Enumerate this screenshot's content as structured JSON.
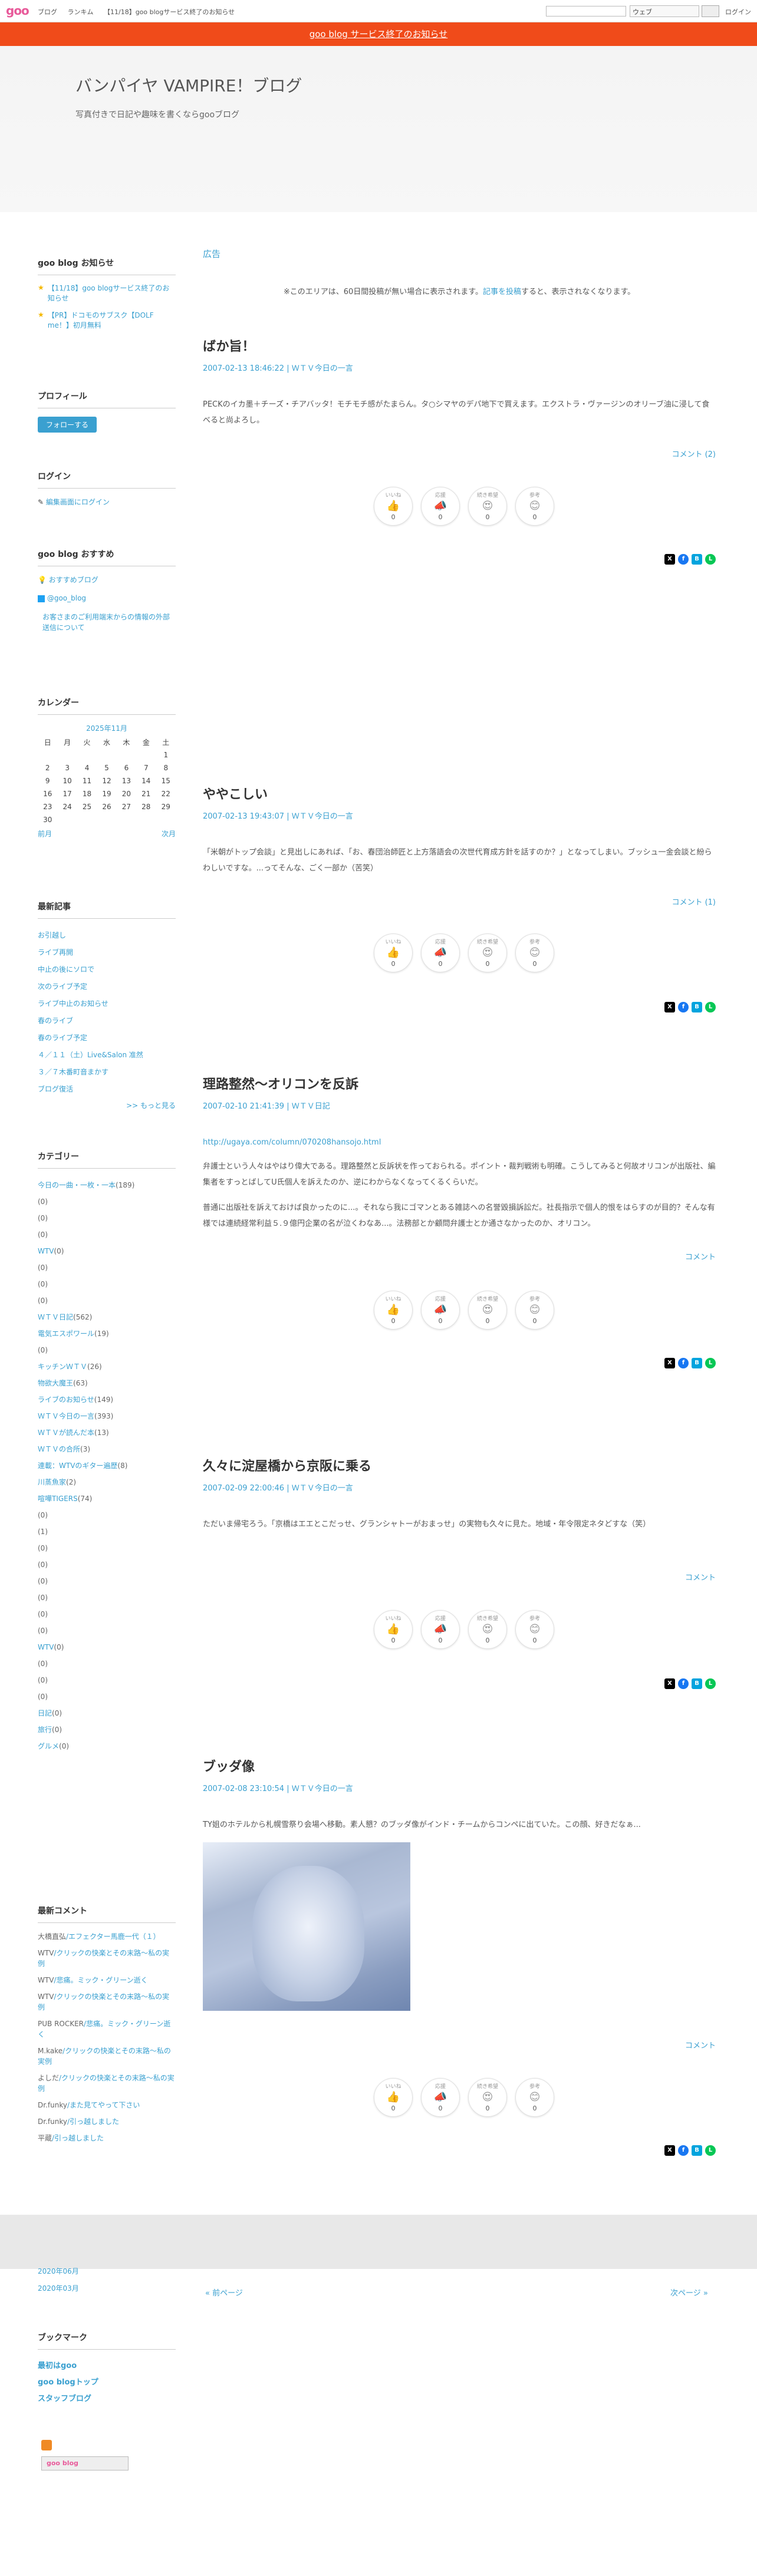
{
  "topbar": {
    "logo": "goo",
    "nav": [
      "ブログ",
      "ランキム",
      "【11/18】goo blogサービス終了のお知らせ"
    ],
    "search_scope": "ウェブ",
    "login": "ログイン"
  },
  "notice": "goo blog サービス終了のお知らせ",
  "blog": {
    "title": "バンパイヤ VAMPIRE！ブログ",
    "description": "写真付きで日記や趣味を書くならgooブログ"
  },
  "sidebar": {
    "notice_heading": "goo blog お知らせ",
    "notices": [
      "【11/18】goo blogサービス終了のお知らせ",
      "【PR】ドコモのサブスク【DOLF me！】初月無料"
    ],
    "profile_heading": "プロフィール",
    "follow_label": "フォローする",
    "login_heading": "ログイン",
    "login_link": "編集画面にログイン",
    "recommend_heading": "goo blog おすすめ",
    "recommend_items": [
      "おすすめブログ",
      "@goo_blog",
      "お客さまのご利用端末からの情報の外部送信について"
    ],
    "calendar_heading": "カレンダー",
    "calendar": {
      "month": "2025年11月",
      "weekdays": [
        "日",
        "月",
        "火",
        "水",
        "木",
        "金",
        "土"
      ],
      "rows": [
        [
          "",
          "",
          "",
          "",
          "",
          "",
          "1"
        ],
        [
          "2",
          "3",
          "4",
          "5",
          "6",
          "7",
          "8"
        ],
        [
          "9",
          "10",
          "11",
          "12",
          "13",
          "14",
          "15"
        ],
        [
          "16",
          "17",
          "18",
          "19",
          "20",
          "21",
          "22"
        ],
        [
          "23",
          "24",
          "25",
          "26",
          "27",
          "28",
          "29"
        ],
        [
          "30",
          "",
          "",
          "",
          "",
          "",
          ""
        ]
      ],
      "prev": "前月",
      "next": "次月"
    },
    "recent_heading": "最新記事",
    "recent": [
      "お引越し",
      "ライブ再開",
      "中止の後にソロで",
      "次のライブ予定",
      "ライブ中止のお知らせ",
      "春のライブ",
      "春のライブ予定",
      "４／１１（土）Live&Salon 准然",
      "３／７木番町音まかす",
      "ブログ復活"
    ],
    "more": ">> もっと見る",
    "category_heading": "カテゴリー",
    "categories": [
      {
        "name": "今日の一曲・一枚・一本",
        "count": "(189)"
      },
      {
        "name": "",
        "count": "(0)"
      },
      {
        "name": "",
        "count": "(0)"
      },
      {
        "name": "",
        "count": "(0)"
      },
      {
        "name": "WTV",
        "count": "(0)"
      },
      {
        "name": "",
        "count": "(0)"
      },
      {
        "name": "",
        "count": "(0)"
      },
      {
        "name": "",
        "count": "(0)"
      },
      {
        "name": "ＷＴＶ日記",
        "count": "(562)"
      },
      {
        "name": "電気エスポワール",
        "count": "(19)"
      },
      {
        "name": "",
        "count": "(0)"
      },
      {
        "name": "キッチンＷＴＶ",
        "count": "(26)"
      },
      {
        "name": "物欲大魔王",
        "count": "(63)"
      },
      {
        "name": "ライブのお知らせ",
        "count": "(149)"
      },
      {
        "name": "ＷＴＶ今日の一言",
        "count": "(393)"
      },
      {
        "name": "ＷＴＶが読んだ本",
        "count": "(13)"
      },
      {
        "name": "ＷＴＶの合所",
        "count": "(3)"
      },
      {
        "name": "連載：WTVのギター遍歴",
        "count": "(8)"
      },
      {
        "name": "川蒸魚家",
        "count": "(2)"
      },
      {
        "name": "喧嘩TIGERS",
        "count": "(74)"
      },
      {
        "name": "",
        "count": "(0)"
      },
      {
        "name": "",
        "count": "(1)"
      },
      {
        "name": "",
        "count": "(0)"
      },
      {
        "name": "",
        "count": "(0)"
      },
      {
        "name": "",
        "count": "(0)"
      },
      {
        "name": "",
        "count": "(0)"
      },
      {
        "name": "",
        "count": "(0)"
      },
      {
        "name": "",
        "count": "(0)"
      },
      {
        "name": "WTV",
        "count": "(0)"
      },
      {
        "name": "",
        "count": "(0)"
      },
      {
        "name": "",
        "count": "(0)"
      },
      {
        "name": "",
        "count": "(0)"
      },
      {
        "name": "日記",
        "count": "(0)"
      },
      {
        "name": "旅行",
        "count": "(0)"
      },
      {
        "name": "グルメ",
        "count": "(0)"
      }
    ],
    "comments_heading": "最新コメント",
    "comments": [
      {
        "user": "大橋直弘",
        "on": "/エフェクター馬鹿一代（１）"
      },
      {
        "user": "WTV",
        "on": "/クリックの快楽とその末路〜私の実例"
      },
      {
        "user": "WTV",
        "on": "/悲痛。ミック・グリーン逝く"
      },
      {
        "user": "WTV",
        "on": "/クリックの快楽とその末路〜私の実例"
      },
      {
        "user": "PUB ROCKER",
        "on": "/悲痛。ミック・グリーン逝く"
      },
      {
        "user": "M.kake",
        "on": "/クリックの快楽とその末路〜私の実例"
      },
      {
        "user": "よしだ",
        "on": "/クリックの快楽とその末路〜私の実例"
      },
      {
        "user": "Dr.funky",
        "on": "/また見てやって下さい"
      },
      {
        "user": "Dr.funky",
        "on": "/引っ越しました"
      },
      {
        "user": "平蔵",
        "on": "/引っ越しました"
      }
    ]
  },
  "ad": {
    "heading": "広告",
    "note_pre": "※このエリアは、60日間投稿が無い場合に表示されます。",
    "note_link": "記事を投稿",
    "note_post": "すると、表示されなくなります。"
  },
  "reactions": [
    {
      "label": "いいね",
      "emoji": "👍",
      "count": "0"
    },
    {
      "label": "応援",
      "emoji": "📣",
      "count": "0"
    },
    {
      "label": "続き希望",
      "emoji": "😍",
      "count": "0"
    },
    {
      "label": "参考",
      "emoji": "😊",
      "count": "0"
    }
  ],
  "posts": [
    {
      "title": "ばか旨！",
      "date": "2007-02-13 18:46:22",
      "category": "ＷＴＶ今日の一言",
      "body": [
        "PECKのイカ墨＋チーズ・チアバッタ！モチモチ感がたまらん。タ○シマヤのデパ地下で買えます。エクストラ・ヴァージンのオリーブ油に浸して食べると尚よろし。"
      ],
      "comment": "コメント (2)"
    },
    {
      "title": "ややこしい",
      "date": "2007-02-13 19:43:07",
      "category": "ＷＴＶ今日の一言",
      "body": [
        "「米朝がトップ会談」と見出しにあれば、「お、春団治師匠と上方落語会の次世代育成方針を話すのか？」となってしまい。ブッシュ一金会談と紛らわしいですな。...ってそんな、ごく一部か（苦笑）"
      ],
      "comment": "コメント (1)"
    },
    {
      "title": "理路整然〜オリコンを反訴",
      "date": "2007-02-10 21:41:39",
      "category": "ＷＴＶ日記",
      "link": "http://ugaya.com/column/070208hansojo.html",
      "body": [
        "弁護士という人々はやはり偉大である。理路整然と反訴状を作っておられる。ポイント・裁判戦術も明確。こうしてみると何故オリコンが出版社、編集者をすっとばしてU氏個人を訴えたのか、逆にわからなくなってくるくらいだ。",
        "普通に出版社を訴えておけば良かったのに...。それなら我にゴマンとある雑誌への名誉毀損訴訟だ。社長指示で個人的恨をはらすのが目的？そんな有様では連続経常利益５.９億円企業の名が泣くわなあ...。法務部とか顧問弁護士とか通さなかったのか、オリコン。"
      ],
      "comment": "コメント"
    },
    {
      "title": "久々に淀屋橋から京阪に乗る",
      "date": "2007-02-09 22:00:46",
      "category": "ＷＴＶ今日の一言",
      "body": [
        "ただいま帰宅ろう。「京橋はエエとこだっせ、グランシャトーがおまっせ」の実物も久々に見た。地域・年令限定ネタどすな（笑）"
      ],
      "comment": "コメント"
    },
    {
      "title": "ブッダ像",
      "date": "2007-02-08 23:10:54",
      "category": "ＷＴＶ今日の一言",
      "body": [
        "TY姐のホテルから札幌雪祭り会場へ移動。素人懇？のブッダ像がインド・チームからコンペに出ていた。この顔、好きだなぁ..."
      ],
      "comment": "コメント"
    }
  ],
  "footer": {
    "archives": [
      "2020年06月",
      "2020年03月"
    ],
    "prev": "« 前ページ",
    "next": "次ページ »",
    "bookmark_heading": "ブックマーク",
    "bookmarks": [
      "最初はgoo",
      "goo blogトップ",
      "スタッフブログ"
    ],
    "badge": "goo blog"
  }
}
